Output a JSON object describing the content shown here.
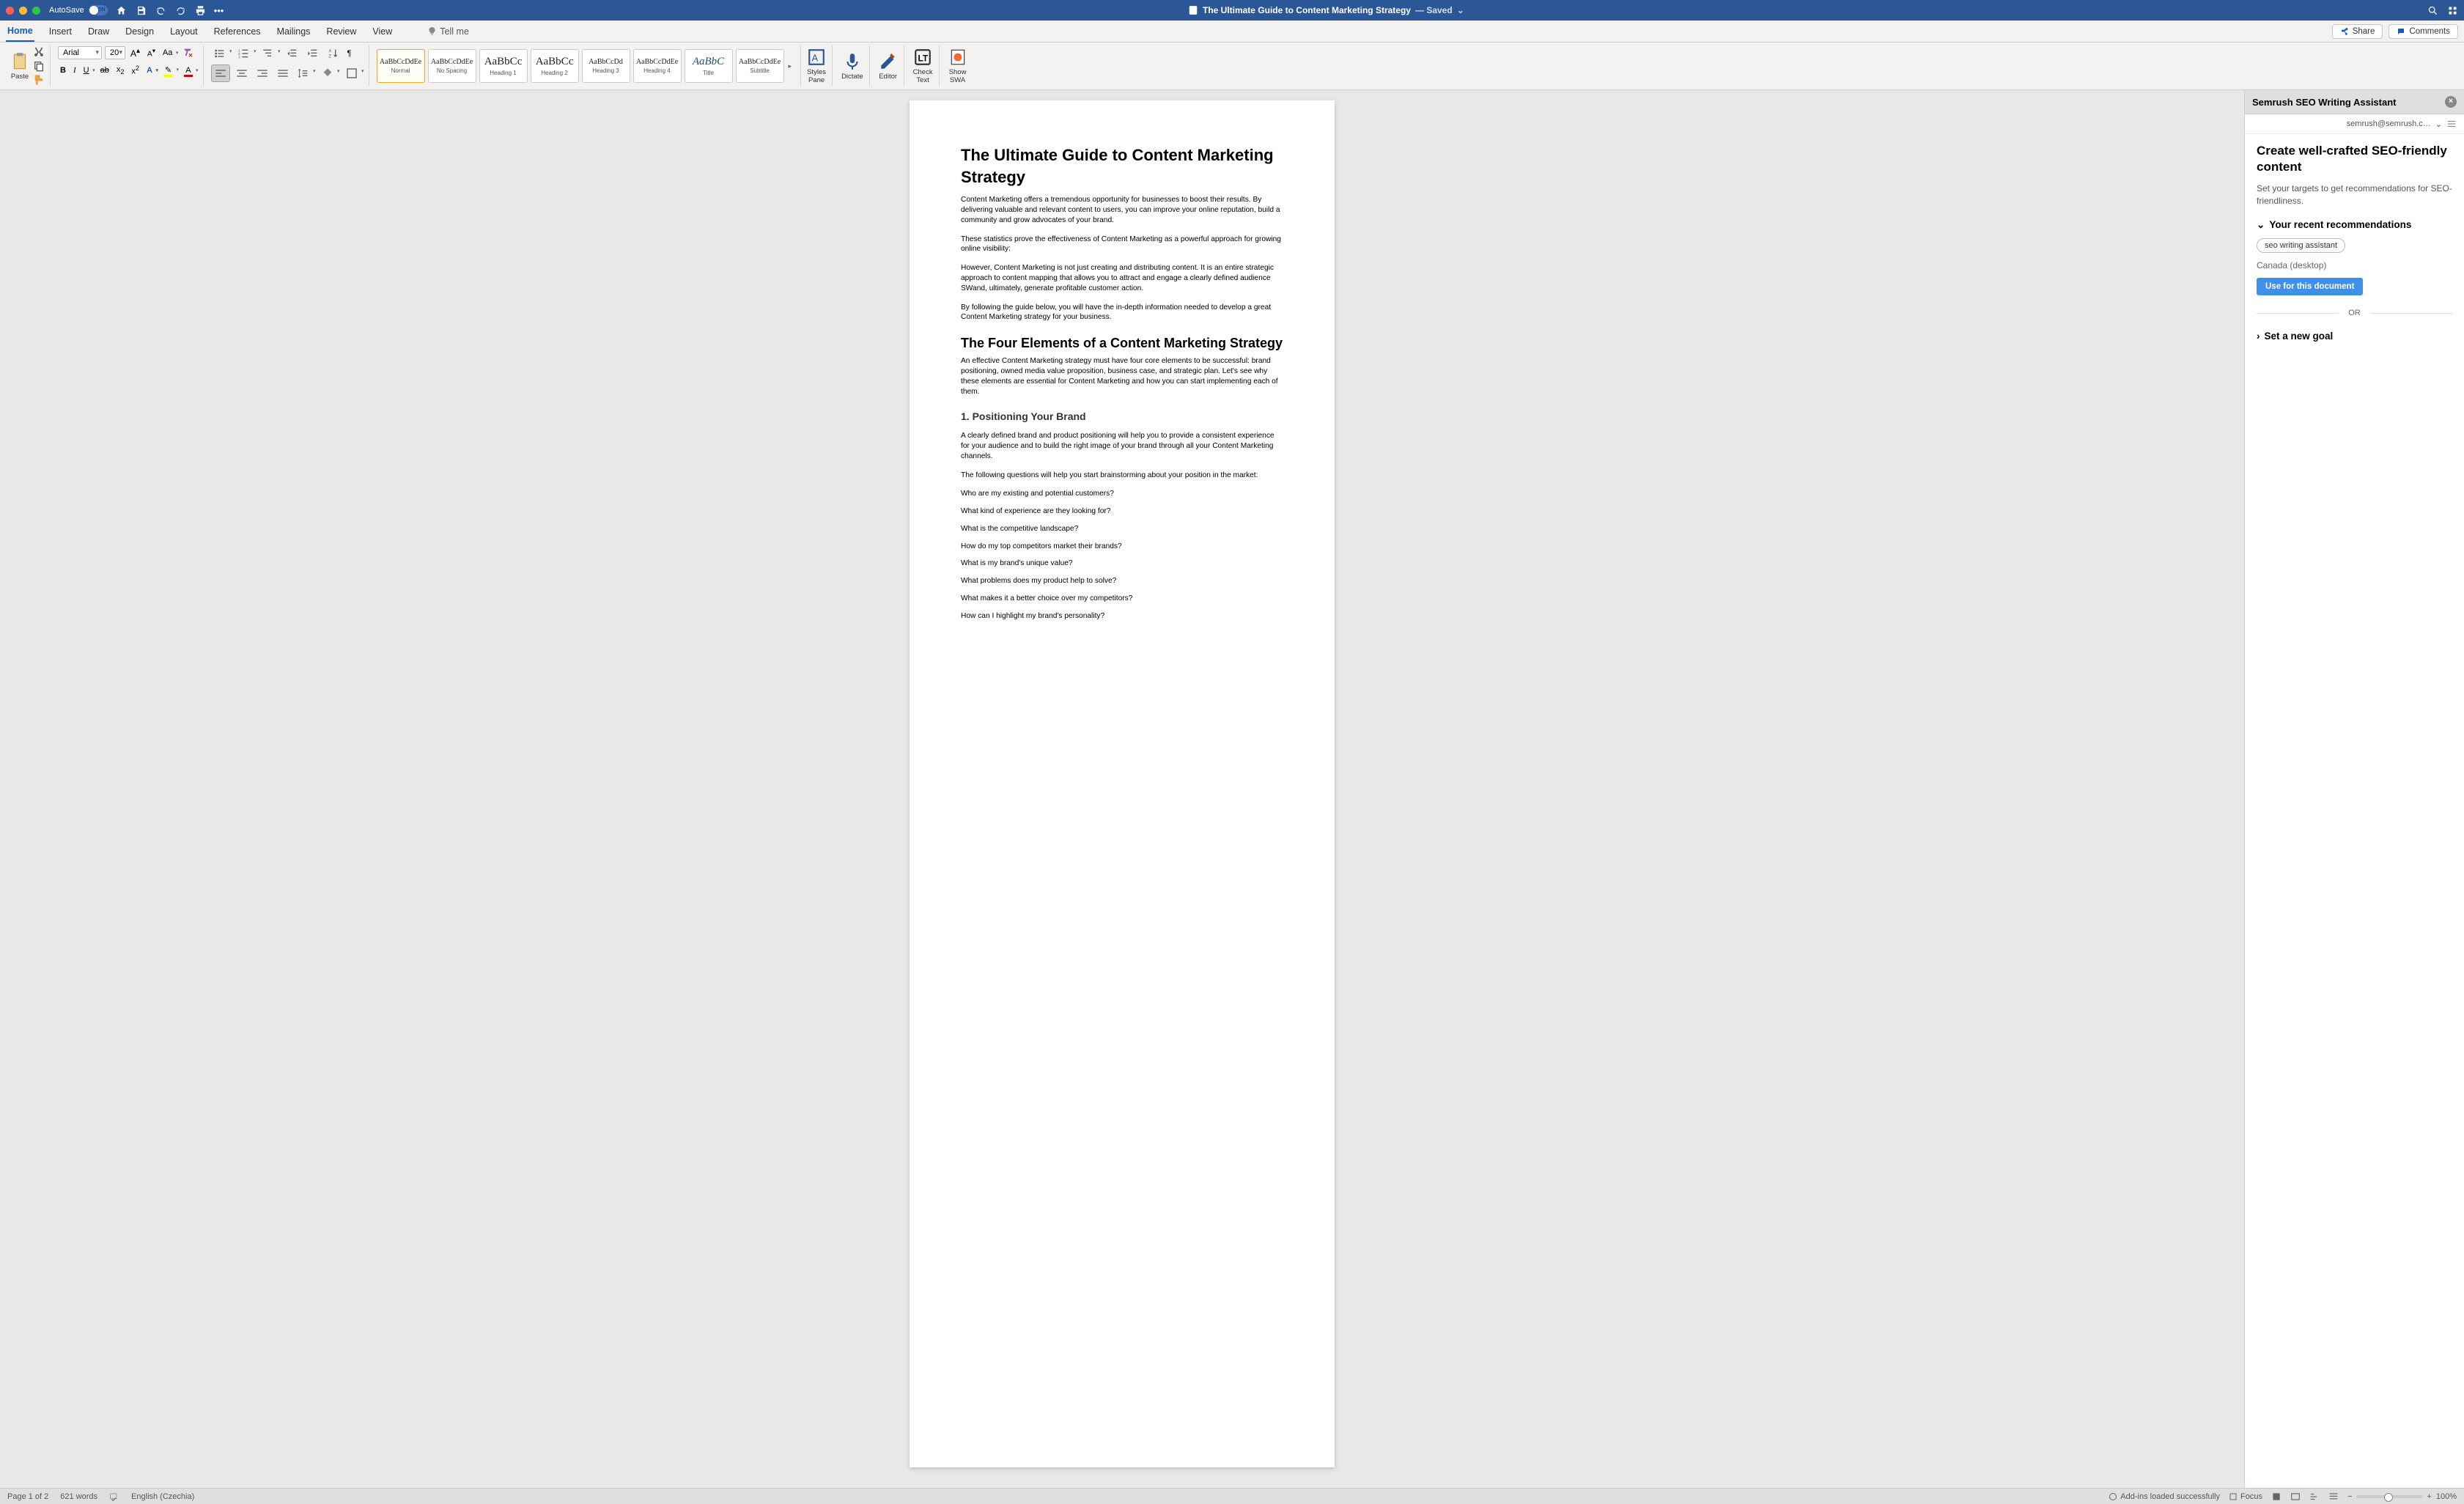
{
  "titlebar": {
    "autosave": "AutoSave",
    "autosave_state": "ON",
    "doc_title": "The Ultimate Guide to Content Marketing Strategy",
    "saved": "— Saved"
  },
  "tabs": {
    "items": [
      "Home",
      "Insert",
      "Draw",
      "Design",
      "Layout",
      "References",
      "Mailings",
      "Review",
      "View"
    ],
    "tell_me": "Tell me",
    "share": "Share",
    "comments": "Comments"
  },
  "ribbon": {
    "paste": "Paste",
    "font_name": "Arial",
    "font_size": "20",
    "styles": [
      {
        "preview": "AaBbCcDdEe",
        "name": "Normal",
        "active": true
      },
      {
        "preview": "AaBbCcDdEe",
        "name": "No Spacing"
      },
      {
        "preview": "AaBbCc",
        "name": "Heading 1",
        "big": true
      },
      {
        "preview": "AaBbCc",
        "name": "Heading 2",
        "big": true
      },
      {
        "preview": "AaBbCcDd",
        "name": "Heading 3"
      },
      {
        "preview": "AaBbCcDdEe",
        "name": "Heading 4"
      },
      {
        "preview": "AaBbC",
        "name": "Title",
        "title": true,
        "big": true
      },
      {
        "preview": "AaBbCcDdEe",
        "name": "Subtitle"
      }
    ],
    "styles_pane": "Styles\nPane",
    "dictate": "Dictate",
    "editor": "Editor",
    "check_text": "Check\nText",
    "show_swa": "Show\nSWA"
  },
  "doc": {
    "h1": "The Ultimate Guide to Content Marketing Strategy",
    "p1": "Content Marketing offers a tremendous opportunity for businesses to boost their results. By delivering valuable and relevant content to users, you can improve your online reputation, build a community and grow advocates of your brand.",
    "p2": "These statistics prove the effectiveness of Content Marketing as a powerful approach for growing online visibility:",
    "p3": "However, Content Marketing is not just creating and distributing content. It is an entire strategic approach to content mapping that allows you to attract and engage a clearly defined audience SWand, ultimately, generate profitable customer action.",
    "p4": "By following the guide below, you will have the in-depth information needed to develop a great Content Marketing strategy for your business.",
    "h2": "The Four Elements of a Content Marketing Strategy",
    "p5": "An effective Content Marketing strategy must have four core elements to be successful: brand positioning, owned media value proposition, business case, and strategic plan. Let's see why these elements are essential for Content Marketing and how you can start implementing each of them.",
    "h3": "1. Positioning Your Brand",
    "p6": "A clearly defined brand and product positioning will help you to provide a consistent experience for your audience and to build the right image of your brand through all your Content Marketing channels.",
    "p7": "The following questions will help you start brainstorming about your position in the market:",
    "q1": "Who are my existing and potential customers?",
    "q2": "What kind of experience are they looking for?",
    "q3": "What is the competitive landscape?",
    "q4": "How do my top competitors market their brands?",
    "q5": "What is my brand's unique value?",
    "q6": "What problems does my product help to solve?",
    "q7": "What makes it a better choice over my competitors?",
    "q8": "How can I highlight my brand's personality?"
  },
  "sidepane": {
    "title": "Semrush SEO Writing Assistant",
    "account": "semrush@semrush.c…",
    "heading": "Create well-crafted SEO-friendly content",
    "sub": "Set your targets to get recommendations for SEO-friendliness.",
    "recent": "Your recent recommendations",
    "chip": "seo writing assistant",
    "region": "Canada (desktop)",
    "use_btn": "Use for this document",
    "or": "OR",
    "new_goal": "Set a new goal"
  },
  "status": {
    "page": "Page 1 of 2",
    "words": "621 words",
    "lang": "English (Czechia)",
    "addins": "Add-ins loaded successfully",
    "focus": "Focus",
    "zoom": "100%"
  }
}
